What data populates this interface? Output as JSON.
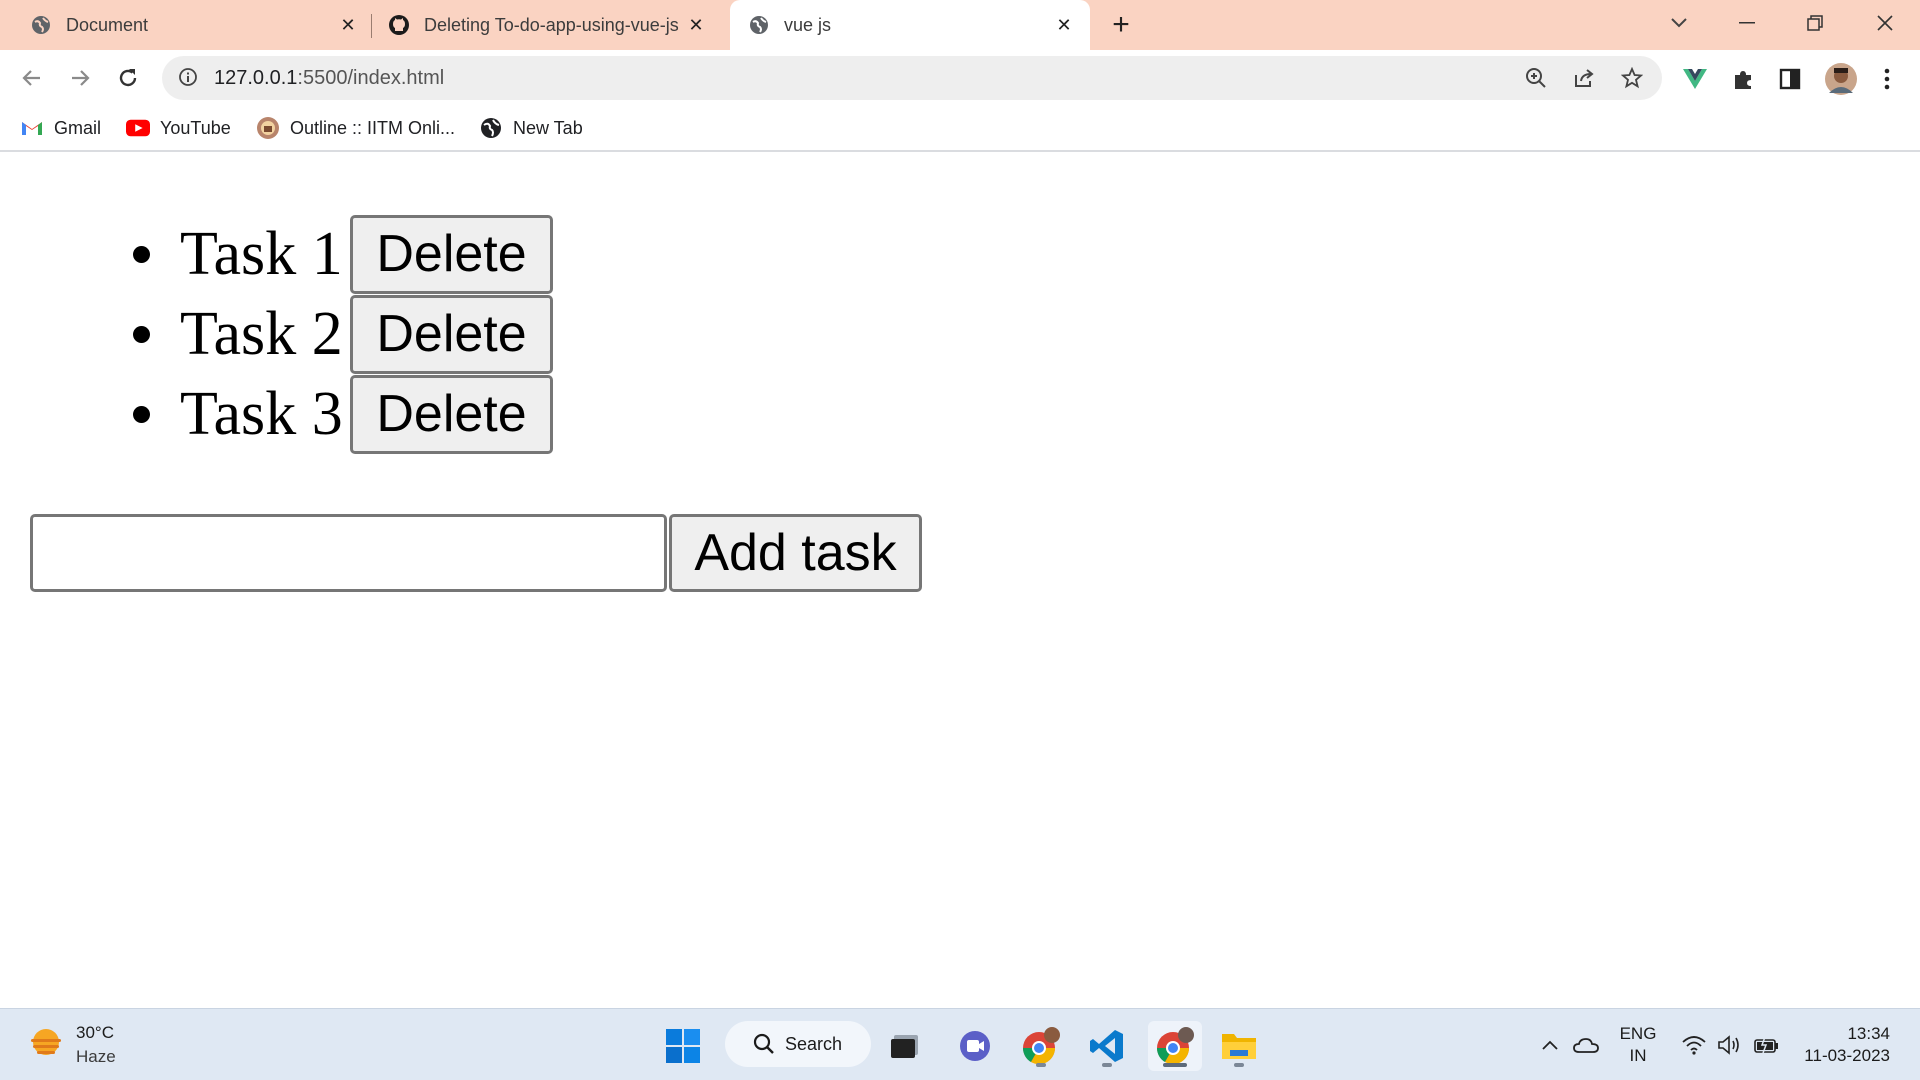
{
  "browser": {
    "tabs": [
      {
        "title": "Document",
        "icon": "globe-icon",
        "active": false
      },
      {
        "title": "Deleting To-do-app-using-vue-js",
        "icon": "github-icon",
        "active": false
      },
      {
        "title": "vue js",
        "icon": "globe-icon",
        "active": true
      }
    ],
    "address": {
      "host": "127.0.0.1",
      "path": ":5500/index.html"
    },
    "bookmarks": [
      {
        "label": "Gmail",
        "icon": "gmail-icon"
      },
      {
        "label": "YouTube",
        "icon": "youtube-icon"
      },
      {
        "label": "Outline :: IITM Onli...",
        "icon": "outline-icon"
      },
      {
        "label": "New Tab",
        "icon": "globe-icon"
      }
    ]
  },
  "page": {
    "tasks": [
      {
        "text": "Task 1",
        "button": "Delete"
      },
      {
        "text": "Task 2",
        "button": "Delete"
      },
      {
        "text": "Task 3",
        "button": "Delete"
      }
    ],
    "input": {
      "value": "",
      "placeholder": ""
    },
    "add_button": "Add task"
  },
  "taskbar": {
    "weather": {
      "temp": "30°C",
      "desc": "Haze"
    },
    "search_label": "Search",
    "lang": {
      "line1": "ENG",
      "line2": "IN"
    },
    "clock": {
      "time": "13:34",
      "date": "11-03-2023"
    }
  },
  "colors": {
    "tab_strip": "#fad3c2",
    "button_face": "#efefef",
    "button_border": "#767676",
    "taskbar": "#dfe8f3"
  }
}
